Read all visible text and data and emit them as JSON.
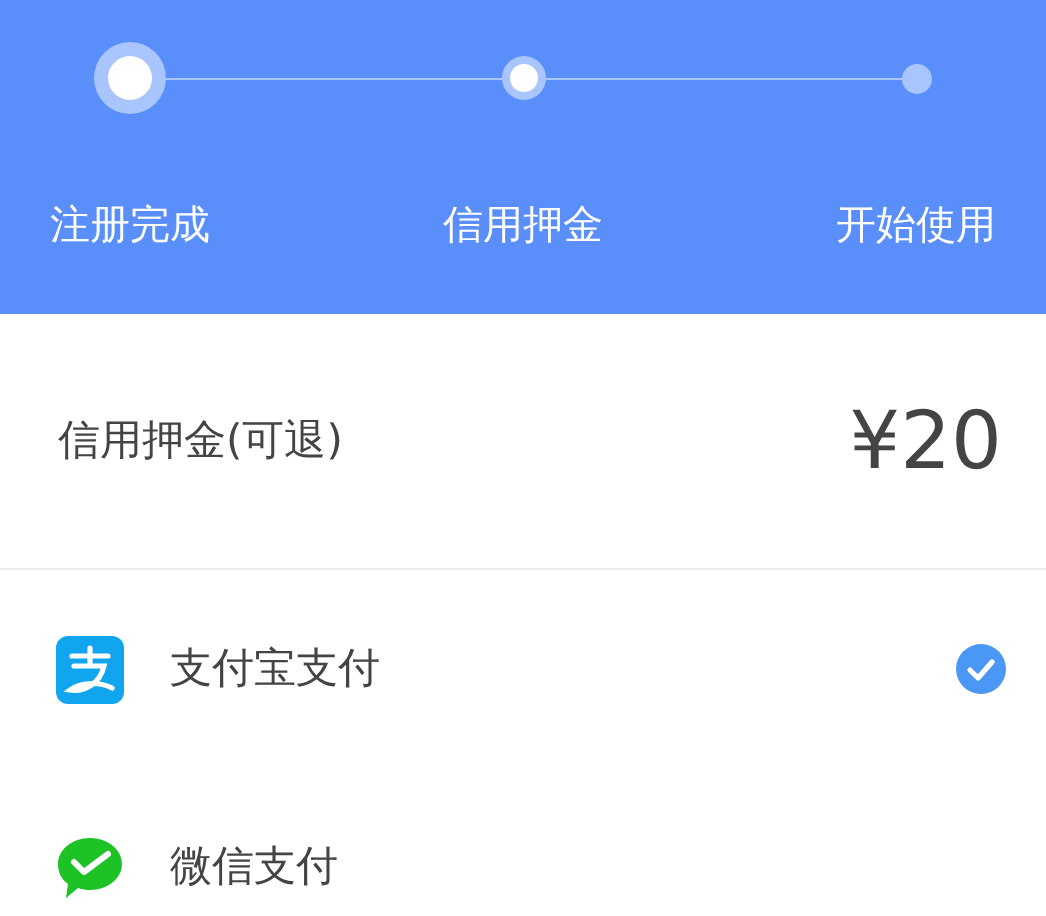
{
  "steps": [
    {
      "label": "注册完成",
      "kind": "done"
    },
    {
      "label": "信用押金",
      "kind": "current"
    },
    {
      "label": "开始使用",
      "kind": "upcoming"
    }
  ],
  "deposit": {
    "label": "信用押金(可退)",
    "amount": "¥20"
  },
  "payment_methods": [
    {
      "kind": "alipay",
      "label": "支付宝支付",
      "selected": true
    },
    {
      "kind": "wechat",
      "label": "微信支付",
      "selected": false
    }
  ]
}
